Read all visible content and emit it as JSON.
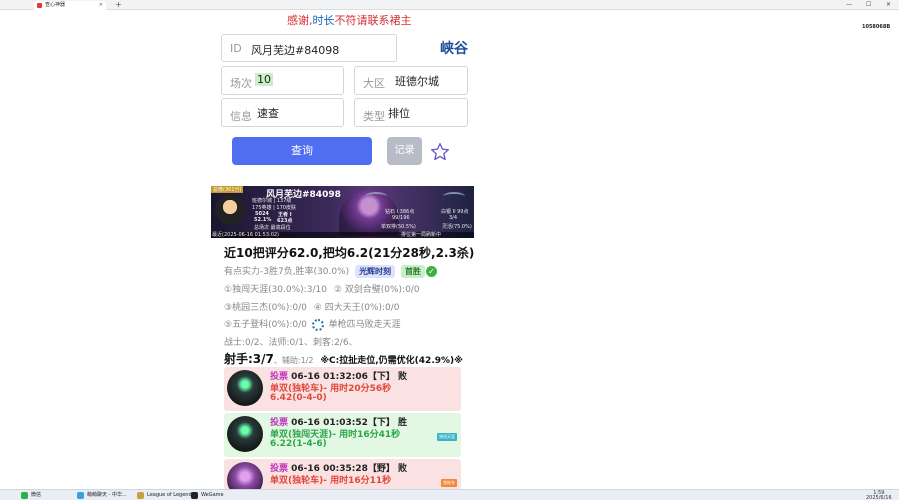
{
  "browser": {
    "tab_title": "查心神器",
    "tab_close": "×",
    "new_tab": "+",
    "window_controls": [
      "—",
      "☐",
      "✕"
    ],
    "corner_tag": "1058068B"
  },
  "notice": {
    "part1": "感谢,",
    "part2": "时长",
    "part3": "不符请联系裙主"
  },
  "form": {
    "id_label": "ID",
    "id_value": "风月芜边#84098",
    "region_title": "峡谷",
    "matches_label": "场次",
    "matches_value": "10",
    "server_label": "大区",
    "server_value": "班德尔城",
    "info_label": "信息",
    "info_value": "速查",
    "type_label": "类型",
    "type_value": "排位",
    "query_button": "查询",
    "record_button": "记录"
  },
  "banner": {
    "rank_tag": "总榜(301分)",
    "player_name": "风月芜边#84098",
    "server_level": "班德尔城 | 137级",
    "heroes_skins": "175英雄 | 170皮肤",
    "score_a": "5024",
    "score_b": "王者 I",
    "rate_a": "52.1%",
    "rate_b": "623点",
    "total_line": "总场次  最高段位",
    "solo_stats": "钻石 I  386点",
    "solo_record": "99/196",
    "solo_rate": "单双排(50.5%)",
    "flex_rank": "白银 II  99点",
    "flex_record": "3/4",
    "flex_rate": "灵活(75.0%)",
    "updated": "最近(2025-06-16 01:53:02)",
    "footer": "排位第一局刷新中"
  },
  "summary": {
    "headline": "近10把评分62.0,把均6.2(21分28秒,2.3杀)",
    "strength_text": "有点实力-3胜7负,胜率(30.0%)",
    "badge_highlight": "光辉时刻",
    "badge_first_win": "首胜",
    "stat_line1a": "①独闯天涯(30.0%):3/10",
    "stat_line1b": "② 双剑合璧(0%):0/0",
    "stat_line2a": "③桃园三杰(0%):0/0",
    "stat_line2b": "④ 四大天王(0%):0/0",
    "stat_line3a": "⑤五子登科(0%):0/0",
    "stat_line3b": "单枪匹马败走天涯",
    "class_line": "战士:0/2、法师:0/1、刺客:2/6、",
    "role_main": "射手:3/7",
    "role_sub": "、辅助:1/2",
    "role_note": "※C:拉扯走位,仍需优化(42.9%)※"
  },
  "matches": [
    {
      "result_class": "loss",
      "vote": "投票",
      "time": "06-16 01:32:06【下】 败",
      "mode": "单双(独轮车)- 用时20分56秒",
      "score": "6.42(0-4-0)",
      "tag": ""
    },
    {
      "result_class": "win",
      "vote": "投票",
      "time": "06-16 01:03:52【下】 胜",
      "mode": "单双(独闯天涯)- 用时16分41秒",
      "score": "6.22(1-4-6)",
      "tag": "独闯天涯"
    },
    {
      "result_class": "loss",
      "vote": "投票",
      "time": "06-16 00:35:28【野】 败",
      "mode": "单双(独轮车)- 用时16分11秒",
      "score": "",
      "tag": "独轮车"
    }
  ],
  "taskbar": {
    "items": [
      "微信",
      "萌萌聊天 - 中华...",
      "League of Legends",
      "WeGame"
    ],
    "time": "1:59",
    "date": "2025/6/16"
  },
  "colors": {
    "accent": "#4f6ff0",
    "loss_bg": "#fbe2e2",
    "win_bg": "#e2f8e2",
    "title": "#1f4e9c"
  }
}
